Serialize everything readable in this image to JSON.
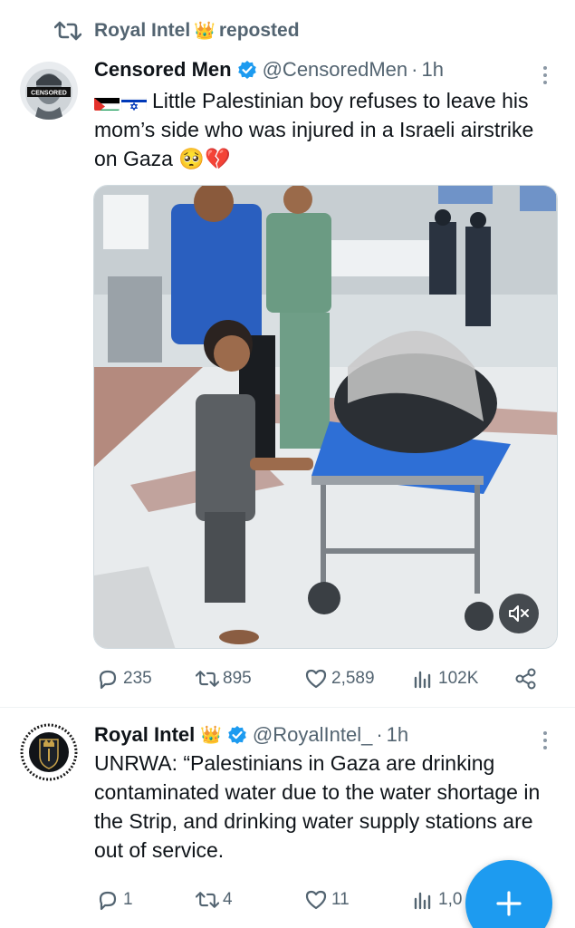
{
  "repost": {
    "label": "Royal Intel",
    "crown": "👑",
    "suffix": "reposted"
  },
  "tweets": [
    {
      "display_name": "Censored Men",
      "handle": "@CensoredMen",
      "separator": "·",
      "time": "1h",
      "avatar_text": "CENSORED",
      "text": "Little Palestinian boy refuses to leave his mom’s side who was injured in a Israeli airstrike on Gaza 🥺💔",
      "media": {
        "type": "video",
        "muted": true
      },
      "stats": {
        "replies": "235",
        "reposts": "895",
        "likes": "2,589",
        "views": "102K"
      }
    },
    {
      "display_name": "Royal Intel",
      "crown": "👑",
      "handle": "@RoyalIntel_",
      "separator": "·",
      "time": "1h",
      "text": "UNRWA: “Palestinians in Gaza are drinking contaminated water due to the water shortage in the Strip, and drinking water supply stations are out of service.",
      "stats": {
        "replies": "1",
        "reposts": "4",
        "likes": "11",
        "views": "1,0"
      }
    }
  ],
  "colors": {
    "accent": "#1d9bf0",
    "text_primary": "#0f1419",
    "text_secondary": "#536471",
    "divider": "#eff3f4"
  },
  "icons": [
    "repost-icon",
    "verified-badge-icon",
    "more-options-icon",
    "reply-icon",
    "like-icon",
    "views-icon",
    "share-icon",
    "mute-icon",
    "compose-plus-icon"
  ]
}
